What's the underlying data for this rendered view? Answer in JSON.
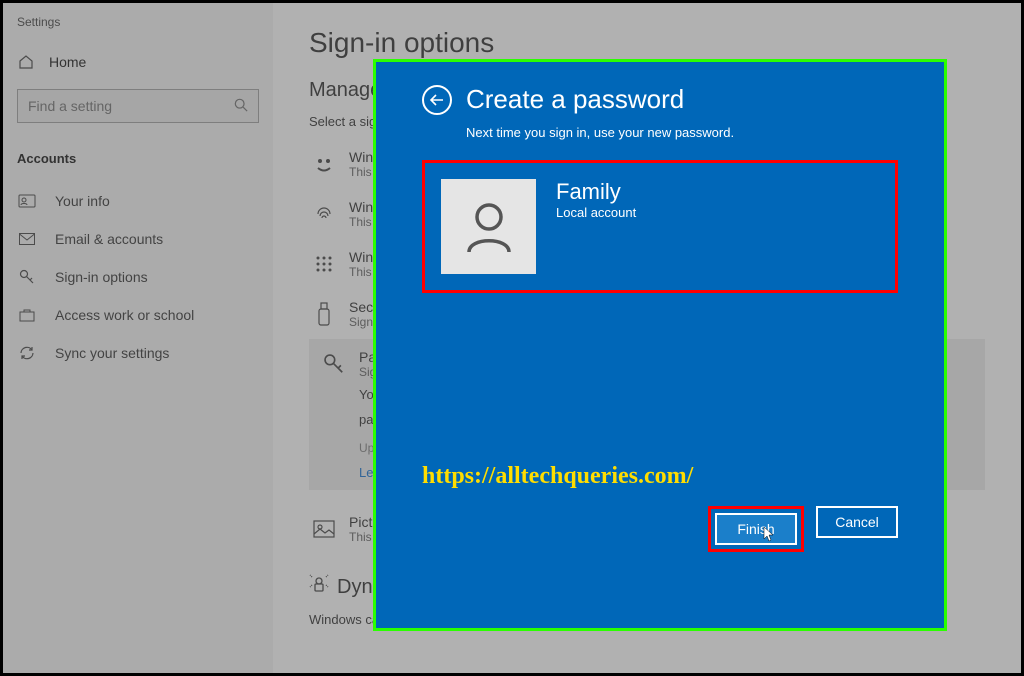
{
  "app_title": "Settings",
  "sidebar": {
    "home": "Home",
    "search_placeholder": "Find a setting",
    "section": "Accounts",
    "items": [
      {
        "label": "Your info"
      },
      {
        "label": "Email & accounts"
      },
      {
        "label": "Sign-in options"
      },
      {
        "label": "Access work or school"
      },
      {
        "label": "Sync your settings"
      }
    ]
  },
  "main": {
    "title": "Sign-in options",
    "subheading": "Manage h",
    "select_text": "Select a sign-",
    "options": [
      {
        "title": "Wind",
        "sub": "This o"
      },
      {
        "title": "Wind",
        "sub": "This o"
      },
      {
        "title": "Wind",
        "sub": "This o"
      },
      {
        "title": "Secur",
        "sub": "Sign i"
      }
    ],
    "password_option": {
      "title": "Passw",
      "sub": "Sign i",
      "body1": "Your a",
      "body2": "passw",
      "updated": "Upda",
      "learn": "Learn"
    },
    "picture_option": {
      "title": "Pictu",
      "sub": "This o"
    },
    "dynamic": "Dynam",
    "bottom": "Windows can use devices that are paired to your PC to know when"
  },
  "modal": {
    "title": "Create a password",
    "subtitle": "Next time you sign in, use your new password.",
    "user_name": "Family",
    "user_type": "Local account",
    "watermark": "https://alltechqueries.com/",
    "finish": "Finish",
    "cancel": "Cancel"
  }
}
